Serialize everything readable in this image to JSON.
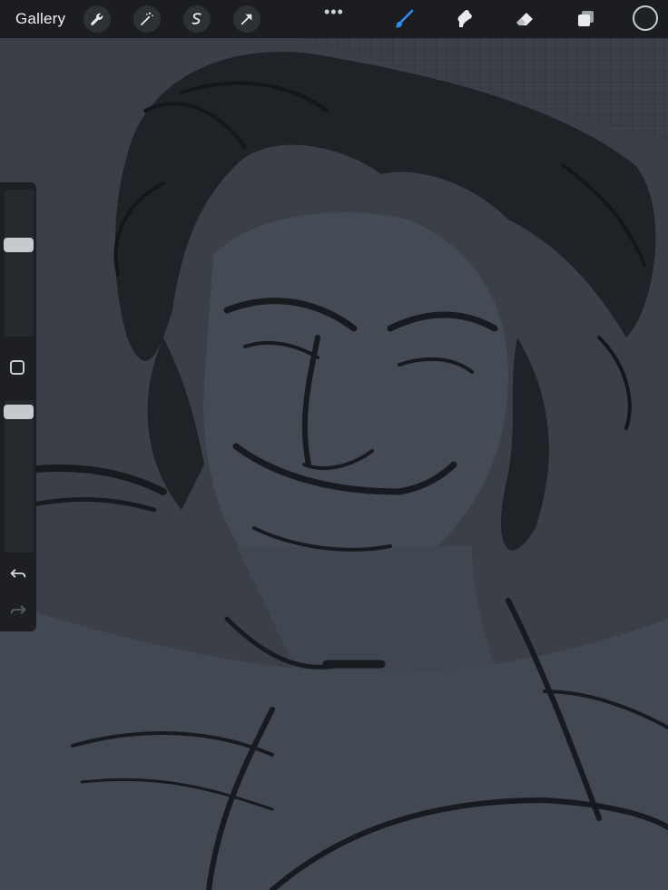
{
  "topbar": {
    "gallery_label": "Gallery",
    "left_tools": [
      "wrench-icon",
      "magic-wand-icon",
      "selection-icon",
      "transform-arrow-icon"
    ],
    "more_menu": "•••",
    "right_tools": [
      "brush-icon",
      "smudge-icon",
      "eraser-icon",
      "layers-icon"
    ],
    "active_tool": "brush",
    "accent_color": "#2f8cf0",
    "current_color": "#1e2227"
  },
  "sidebar": {
    "brush_size_level": 0.64,
    "opacity_level": 1.0,
    "modify_button": "square-icon",
    "undo": "undo-icon",
    "redo": "redo-icon"
  },
  "canvas": {
    "content": "artwork",
    "background_color": "#3b4048"
  }
}
